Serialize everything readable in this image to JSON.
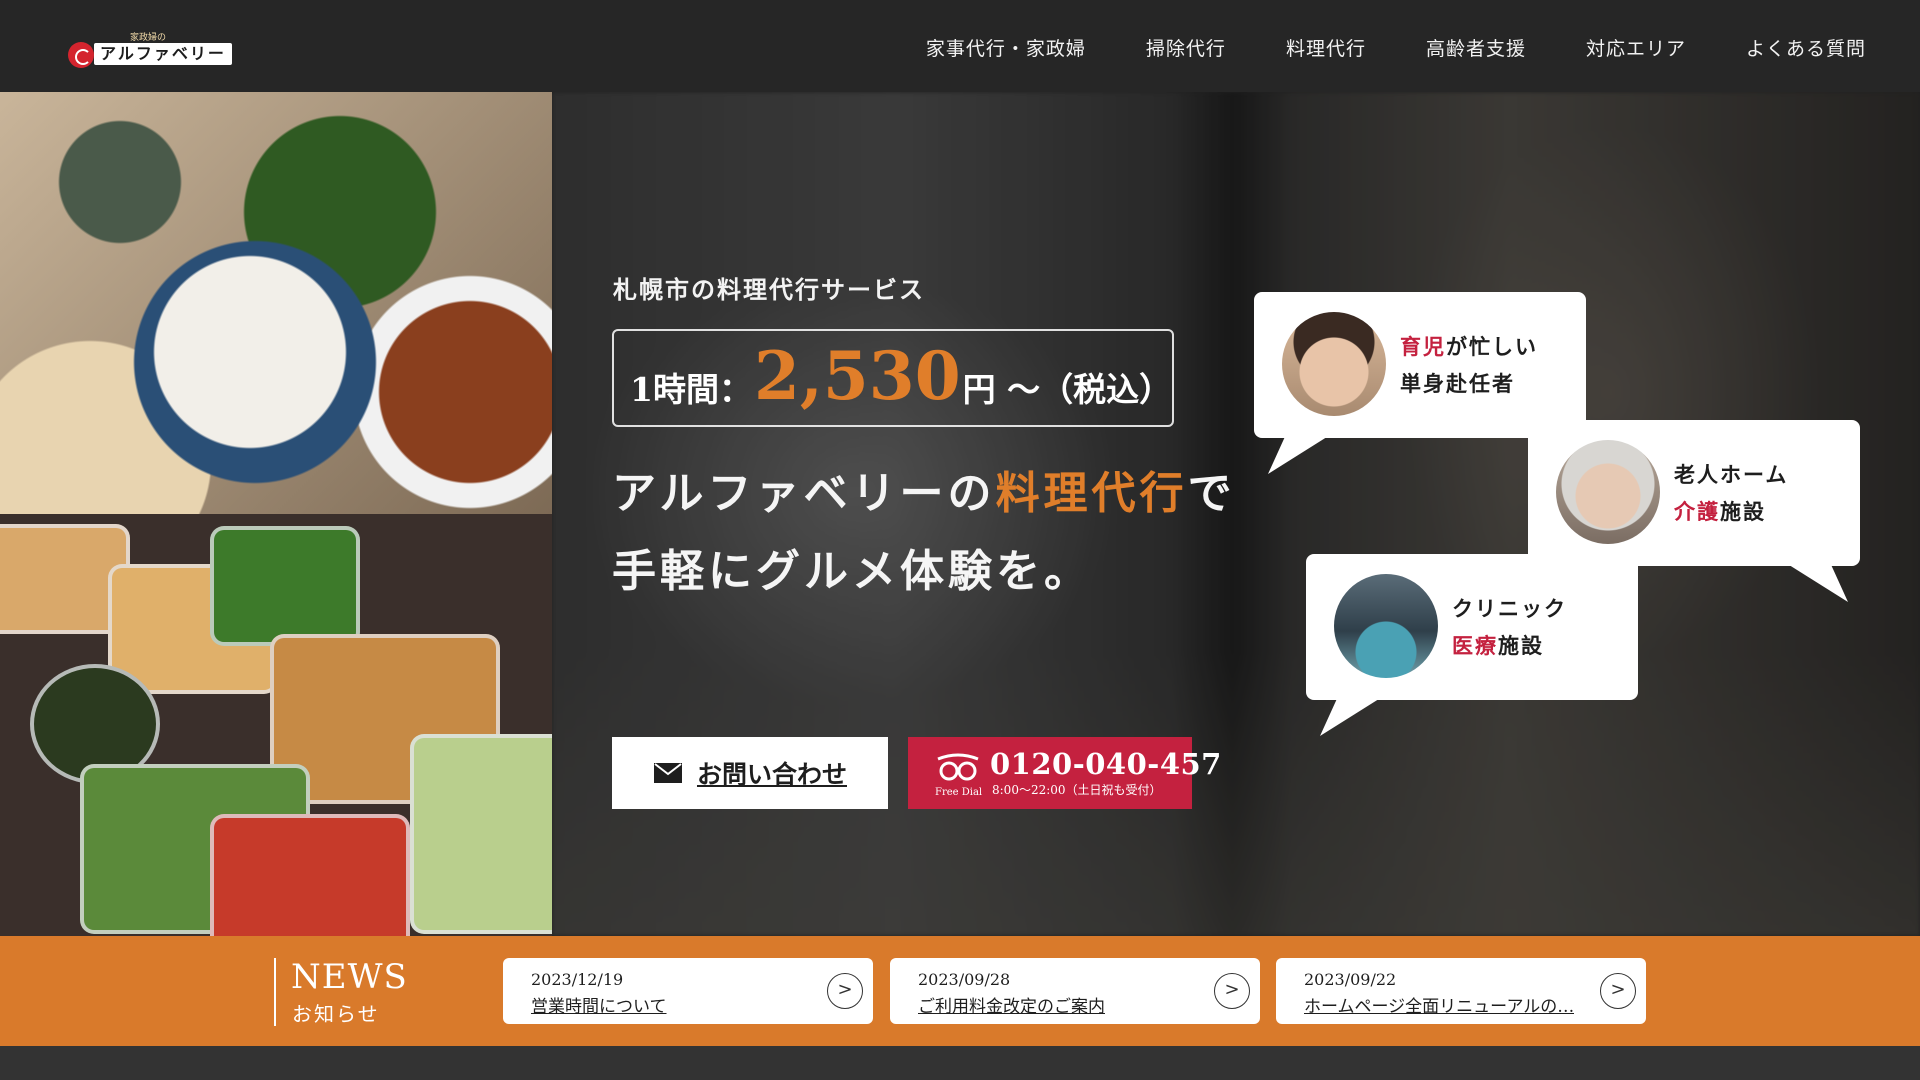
{
  "header": {
    "logo_small": "家政婦の",
    "logo_word": "アルファベリー",
    "nav": [
      {
        "label": "家事代行・家政婦"
      },
      {
        "label": "掃除代行"
      },
      {
        "label": "料理代行"
      },
      {
        "label": "高齢者支援"
      },
      {
        "label": "対応エリア"
      },
      {
        "label": "よくある質問"
      }
    ]
  },
  "hero": {
    "subtitle": "札幌市の料理代行サービス",
    "price_label": "1時間：",
    "price_value": "2,530",
    "price_suffix": "円 ～（税込）",
    "headline_line1_pre": "アルファベリーの",
    "headline_line1_accent": "料理代行",
    "headline_line1_post": "で",
    "headline_line2": "手軽にグルメ体験を。",
    "contact_button": "お問い合わせ",
    "tel_number": "0120-040-457",
    "tel_free_label": "Free Dial",
    "tel_hours": "8:00～22:00（土日祝も受付）",
    "accent_color": "#e07e2a",
    "brand_red": "#c4213f"
  },
  "bubbles": [
    {
      "accent": "育児",
      "line1_rest": "が忙しい",
      "line2": "単身赴任者"
    },
    {
      "line1": "老人ホーム",
      "accent": "介護",
      "line2_rest": "施設"
    },
    {
      "line1": "クリニック",
      "accent": "医療",
      "line2_rest": "施設"
    }
  ],
  "news": {
    "title": "NEWS",
    "subtitle": "お知らせ",
    "items": [
      {
        "date": "2023/12/19",
        "text": "営業時間について"
      },
      {
        "date": "2023/09/28",
        "text": "ご利用料金改定のご案内"
      },
      {
        "date": "2023/09/22",
        "text": "ホームページ全面リニューアルの…"
      }
    ],
    "arrow": ">"
  }
}
